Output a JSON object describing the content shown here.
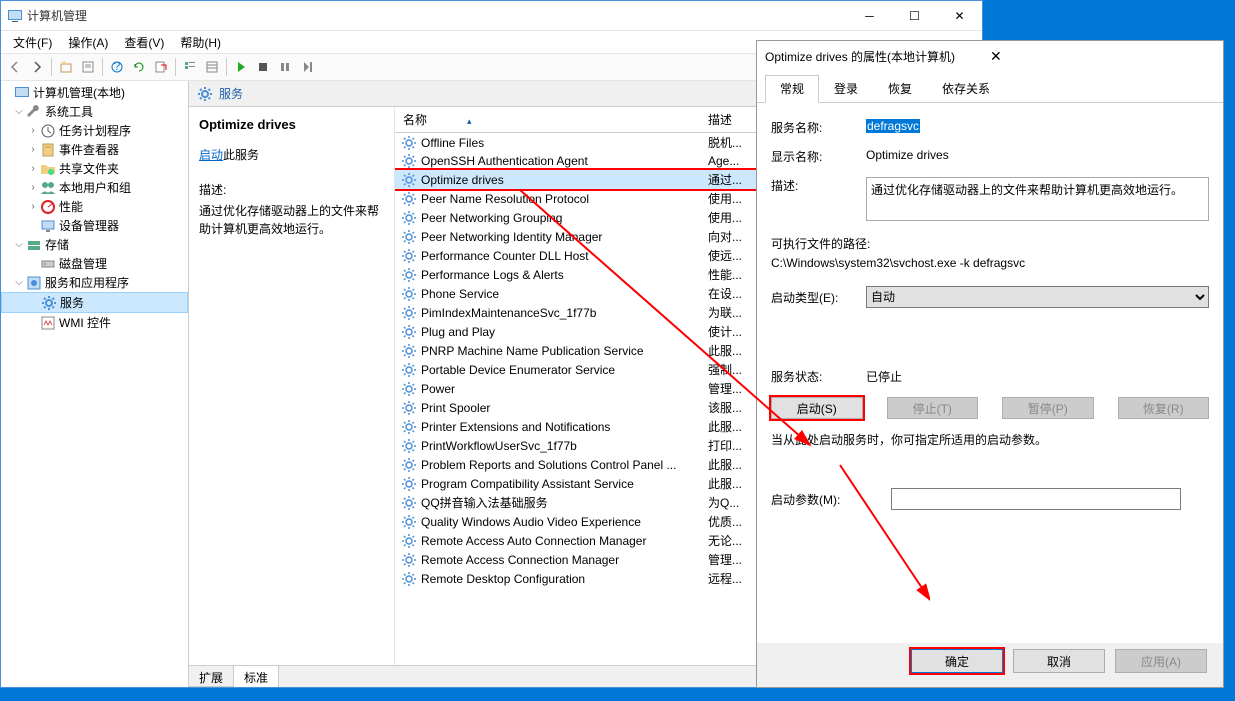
{
  "window": {
    "title": "计算机管理",
    "menu": [
      "文件(F)",
      "操作(A)",
      "查看(V)",
      "帮助(H)"
    ]
  },
  "tree": {
    "root": "计算机管理(本地)",
    "sys": "系统工具",
    "sched": "任务计划程序",
    "eventv": "事件查看器",
    "shared": "共享文件夹",
    "users": "本地用户和组",
    "perf": "性能",
    "devmgr": "设备管理器",
    "storage": "存储",
    "diskmgmt": "磁盘管理",
    "appsvc": "服务和应用程序",
    "services": "服务",
    "wmi": "WMI 控件"
  },
  "panel": {
    "header": "服务",
    "title": "Optimize drives",
    "start_prefix": "启动",
    "start_suffix": "此服务",
    "desc_label": "描述:",
    "desc_text": "通过优化存储驱动器上的文件来帮助计算机更高效地运行。"
  },
  "cols": {
    "name": "名称",
    "desc": "描述"
  },
  "rows": [
    {
      "n": "Offline Files",
      "d": "脱机..."
    },
    {
      "n": "OpenSSH Authentication Agent",
      "d": "Age..."
    },
    {
      "n": "Optimize drives",
      "d": "通过..."
    },
    {
      "n": "Peer Name Resolution Protocol",
      "d": "使用..."
    },
    {
      "n": "Peer Networking Grouping",
      "d": "使用..."
    },
    {
      "n": "Peer Networking Identity Manager",
      "d": "向对..."
    },
    {
      "n": "Performance Counter DLL Host",
      "d": "使远..."
    },
    {
      "n": "Performance Logs & Alerts",
      "d": "性能..."
    },
    {
      "n": "Phone Service",
      "d": "在设..."
    },
    {
      "n": "PimIndexMaintenanceSvc_1f77b",
      "d": "为联..."
    },
    {
      "n": "Plug and Play",
      "d": "使计..."
    },
    {
      "n": "PNRP Machine Name Publication Service",
      "d": "此服..."
    },
    {
      "n": "Portable Device Enumerator Service",
      "d": "强制..."
    },
    {
      "n": "Power",
      "d": "管理..."
    },
    {
      "n": "Print Spooler",
      "d": "该服..."
    },
    {
      "n": "Printer Extensions and Notifications",
      "d": "此服..."
    },
    {
      "n": "PrintWorkflowUserSvc_1f77b",
      "d": "打印..."
    },
    {
      "n": "Problem Reports and Solutions Control Panel ...",
      "d": "此服..."
    },
    {
      "n": "Program Compatibility Assistant Service",
      "d": "此服..."
    },
    {
      "n": "QQ拼音输入法基础服务",
      "d": "为Q..."
    },
    {
      "n": "Quality Windows Audio Video Experience",
      "d": "优质..."
    },
    {
      "n": "Remote Access Auto Connection Manager",
      "d": "无论..."
    },
    {
      "n": "Remote Access Connection Manager",
      "d": "管理..."
    },
    {
      "n": "Remote Desktop Configuration",
      "d": "远程..."
    }
  ],
  "tabs_bottom": {
    "ext": "扩展",
    "std": "标准"
  },
  "dialog": {
    "title": "Optimize drives 的属性(本地计算机)",
    "tabs": [
      "常规",
      "登录",
      "恢复",
      "依存关系"
    ],
    "svc_name_label": "服务名称:",
    "svc_name": "defragsvc",
    "disp_name_label": "显示名称:",
    "disp_name": "Optimize drives",
    "desc_label": "描述:",
    "desc": "通过优化存储驱动器上的文件来帮助计算机更高效地运行。",
    "path_label": "可执行文件的路径:",
    "path": "C:\\Windows\\system32\\svchost.exe -k defragsvc",
    "startup_label": "启动类型(E):",
    "startup": "自动",
    "status_label": "服务状态:",
    "status": "已停止",
    "btn_start": "启动(S)",
    "btn_stop": "停止(T)",
    "btn_pause": "暂停(P)",
    "btn_resume": "恢复(R)",
    "hint": "当从此处启动服务时，你可指定所适用的启动参数。",
    "param_label": "启动参数(M):",
    "ok": "确定",
    "cancel": "取消",
    "apply": "应用(A)"
  }
}
